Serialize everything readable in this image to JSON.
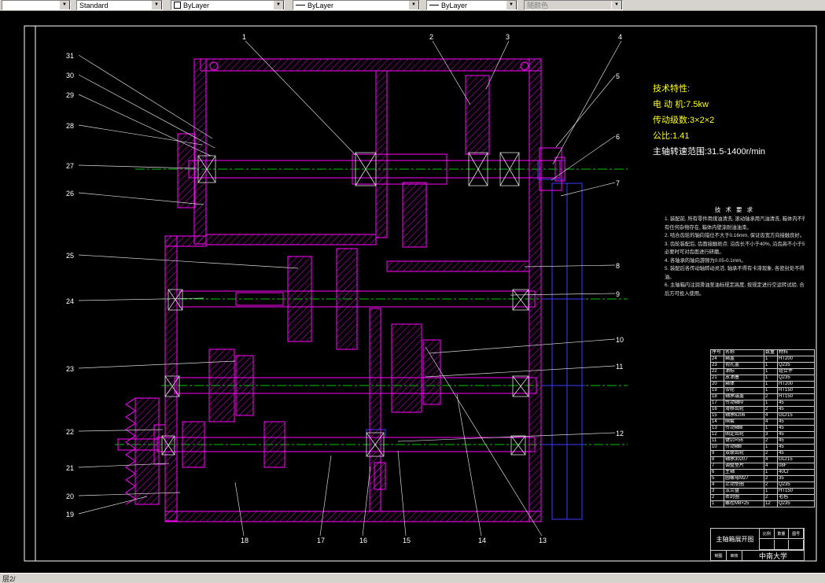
{
  "icons": {
    "dropdown_arrow": "▼"
  },
  "toolbar": {
    "combo_blank": "",
    "style": "Standard",
    "color": "ByLayer",
    "linetype": "ByLayer",
    "lineweight": "ByLayer",
    "plot_style": "随颜色"
  },
  "status_bar": {
    "text": "层2/"
  },
  "drawing": {
    "tech_spec": {
      "title": "技术特性:",
      "lines": [
        "电 动 机:7.5kw",
        "传动级数:3×2×2",
        "公比:1.41",
        "主轴转速范围:31.5-1400r/min"
      ]
    },
    "tech_req": {
      "title": "技 术 要 求",
      "lines": [
        "1. 装配前, 所有零件用煤油清洗, 滚动轴承用汽油清洗, 箱体内不得",
        "    有任何杂物存在, 箱体内壁涂耐油油漆。",
        "2. 啮合齿轮的轴向错位不大于0.16mm, 保证齿宽方向接触良好。",
        "3. 齿轮装配后, 齿面接触斑点: 沿齿长不小于40%, 沿齿高不小于50%,",
        "    必要时可对齿面进行研磨。",
        "4. 各轴承的轴向游隙为0.05-0.1mm。",
        "5. 装配后各传动轴转动灵活, 轴承不得有卡滞现象, 各密封处不得漏",
        "    油。",
        "6. 主轴箱内注润滑油至油标规定高度, 按规定进行空运转试验, 合格",
        "    后方可投入使用。"
      ]
    },
    "callouts": {
      "left": [
        "31",
        "30",
        "29",
        "28",
        "27",
        "26",
        "25",
        "24",
        "23",
        "22",
        "21",
        "20",
        "19"
      ],
      "top": [
        "1",
        "2",
        "3",
        "4"
      ],
      "right": [
        "5",
        "6",
        "7",
        "8",
        "9",
        "10",
        "11",
        "12"
      ],
      "bottom": [
        "18",
        "17",
        "16",
        "15",
        "14",
        "13"
      ]
    },
    "parts_table": {
      "header": [
        "序号",
        "名称",
        "数量",
        "材料"
      ],
      "rows": [
        [
          "24",
          "箱盖",
          "1",
          "HT200"
        ],
        [
          "23",
          "视孔盖",
          "1",
          "Q235"
        ],
        [
          "22",
          "油标",
          "1",
          "组合件"
        ],
        [
          "21",
          "放油塞",
          "1",
          "Q235"
        ],
        [
          "20",
          "箱体",
          "1",
          "HT200"
        ],
        [
          "19",
          "带轮",
          "1",
          "HT150"
        ],
        [
          "18",
          "轴承端盖",
          "2",
          "HT150"
        ],
        [
          "17",
          "传动轴Ⅳ",
          "1",
          "45"
        ],
        [
          "16",
          "滑移齿轮",
          "2",
          "45"
        ],
        [
          "15",
          "轴承6206",
          "4",
          "GCr15"
        ],
        [
          "14",
          "隔套",
          "4",
          "45"
        ],
        [
          "13",
          "传动轴Ⅲ",
          "1",
          "45"
        ],
        [
          "12",
          "固定齿轮",
          "3",
          "45"
        ],
        [
          "11",
          "键10×56",
          "2",
          "45"
        ],
        [
          "10",
          "传动轴Ⅱ",
          "1",
          "45"
        ],
        [
          "9",
          "双联齿轮",
          "2",
          "45"
        ],
        [
          "8",
          "轴承30207",
          "4",
          "GCr15"
        ],
        [
          "7",
          "调整垫片",
          "4",
          "08F"
        ],
        [
          "6",
          "主轴",
          "1",
          "40Cr"
        ],
        [
          "5",
          "圆螺母M27",
          "2",
          "35"
        ],
        [
          "4",
          "止动垫圈",
          "2",
          "Q235"
        ],
        [
          "3",
          "法兰盘",
          "1",
          "HT150"
        ],
        [
          "2",
          "密封圈",
          "2",
          "毛毡"
        ],
        [
          "1",
          "螺栓M8×25",
          "12",
          "Q235"
        ]
      ]
    },
    "title_block": {
      "title": "主轴箱展开图",
      "org": "中南大学",
      "f1": "比例",
      "f2": "数量",
      "f3": "图号",
      "f4": "制图",
      "f5": "审核"
    },
    "colors": {
      "section": "#ff00ff",
      "centerline": "#00c400",
      "dimension": "#3c3cff",
      "outline": "#ffffff"
    }
  }
}
